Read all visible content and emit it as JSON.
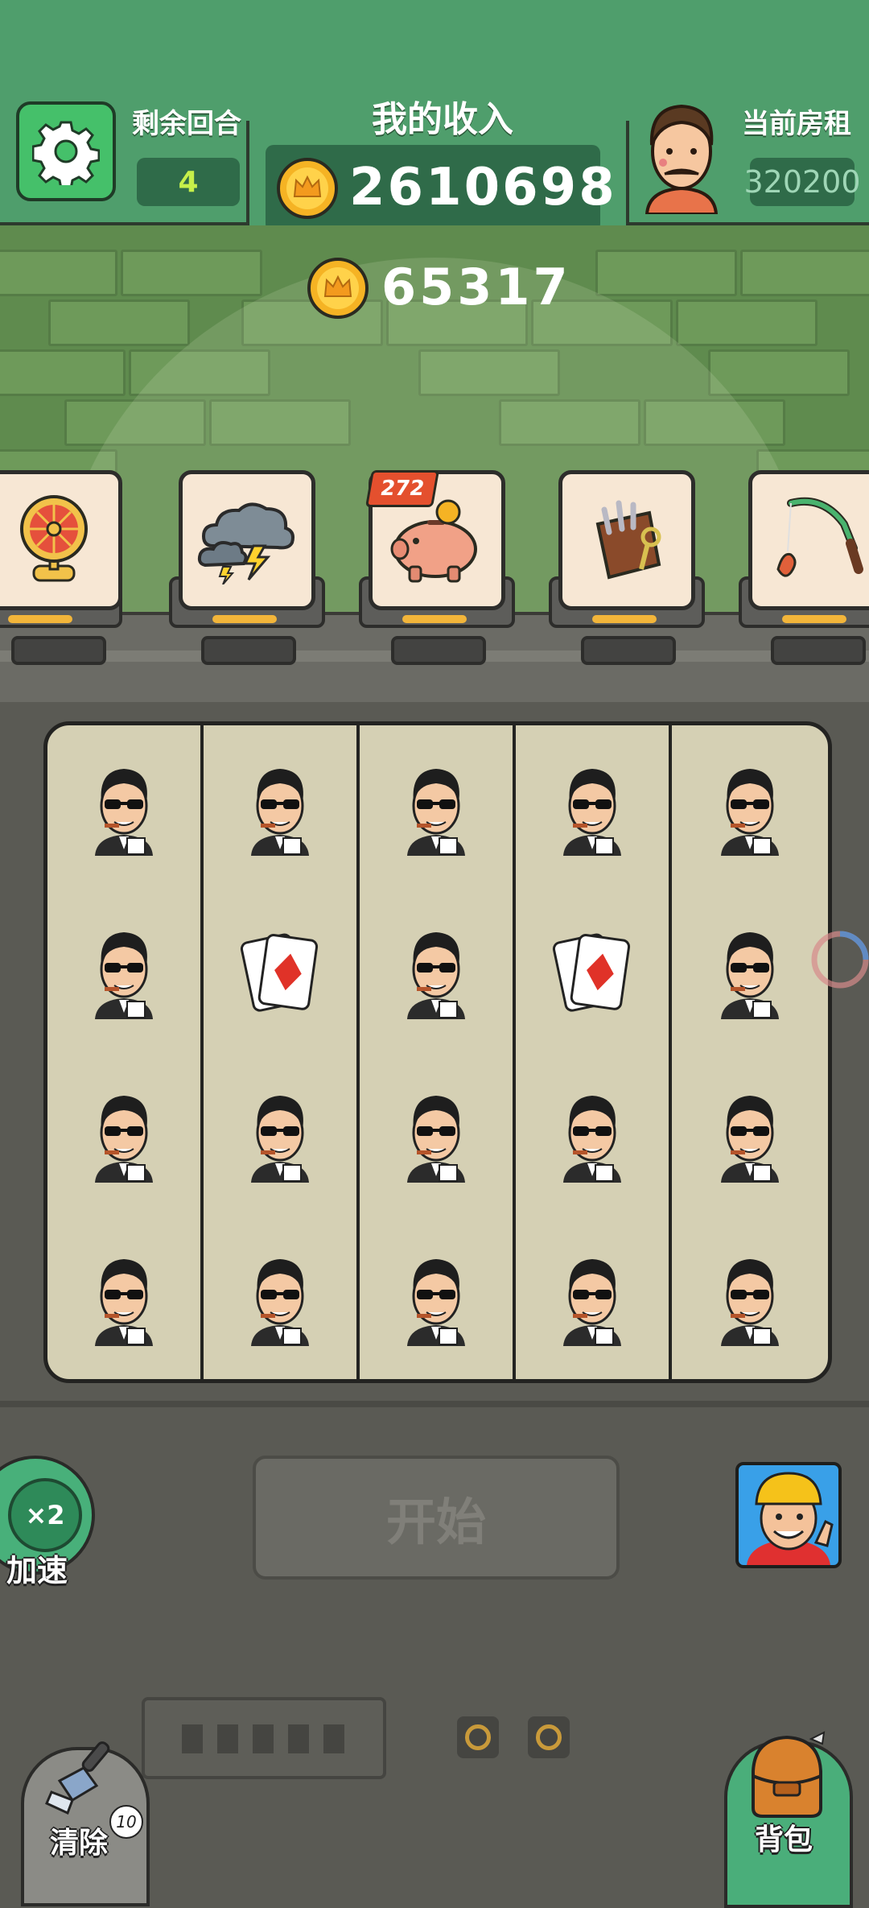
{
  "header": {
    "rounds_label": "剩余回合",
    "rounds_value": "4",
    "income_label": "我的收入",
    "income_value": "2610698",
    "rent_label": "当前房租",
    "rent_value": "320200",
    "bonus_value": "65317"
  },
  "items": [
    {
      "icon": "fan-icon"
    },
    {
      "icon": "storm-cloud-icon"
    },
    {
      "icon": "piggy-bank-icon",
      "badge": "272"
    },
    {
      "icon": "tool-bag-icon"
    },
    {
      "icon": "fishing-rod-icon"
    }
  ],
  "board": {
    "columns": [
      [
        "gangster",
        "gangster",
        "gangster",
        "gangster"
      ],
      [
        "gangster",
        "cards",
        "gangster",
        "gangster"
      ],
      [
        "gangster",
        "gangster",
        "gangster",
        "gangster"
      ],
      [
        "gangster",
        "cards",
        "gangster",
        "gangster"
      ],
      [
        "gangster",
        "gangster",
        "gangster",
        "gangster"
      ]
    ]
  },
  "controls": {
    "start_label": "开始",
    "speed_badge": "×2",
    "speed_label": "加速",
    "clear_label": "清除",
    "clear_count": "10",
    "bag_label": "背包"
  },
  "colors": {
    "header_green": "#4f9e6c",
    "board_bg": "#d5d0b4",
    "coin_gold": "#f5b324"
  }
}
